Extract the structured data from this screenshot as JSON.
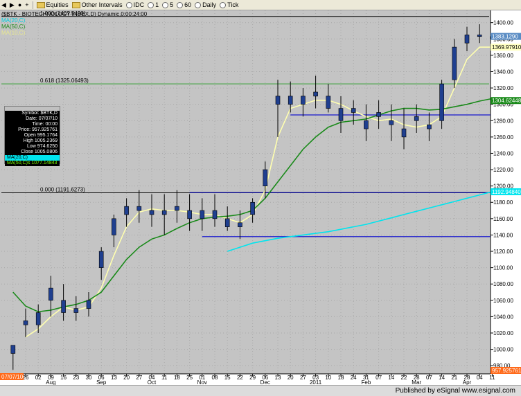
{
  "toolbar": {
    "items": [
      "Equities",
      "Other Intervals",
      "IDC",
      "1",
      "5",
      "60",
      "Daily",
      "Tick"
    ]
  },
  "chart_header": {
    "title": "($BTK - BIOTECHNOLOGY INDEX,D) Dynamic,0:00:24:00",
    "ind_ma20": "MA(20,C)",
    "ind_ma50": "MA(50,C)",
    "ind_ma10": "MA(10,C)"
  },
  "databox": {
    "header": "OK",
    "symbol": "Symbol: $BTK,D",
    "date": "Date: 07/07/10",
    "time": "Time: 00:00",
    "price": "Price: 957.925761",
    "open": "Open 995.1764",
    "high": "High 1005.2369",
    "low": "Low 974.6250",
    "close": "Close 1005.0806",
    "ma20": "MA(20,C)",
    "ma50": "MA(50,C)s 1077.14843"
  },
  "footer": {
    "text": "Published by eSignal  www.esignal.com"
  },
  "chart_data": {
    "type": "line",
    "title": "($BTK - BIOTECHNOLOGY INDEX,D) Dynamic,0:00:24:00",
    "xlabel": "",
    "ylabel": "",
    "ylim": [
      970,
      1415
    ],
    "grid": true,
    "y_ticks": [
      980,
      1000,
      1020,
      1040,
      1060,
      1080,
      1100,
      1120,
      1140,
      1160,
      1180,
      1200,
      1220,
      1240,
      1260,
      1280,
      1300,
      1320,
      1340,
      1360,
      1380,
      1400
    ],
    "x_tick_labels": [
      "19",
      "26",
      "02",
      "09",
      "16",
      "23",
      "30",
      "06",
      "13",
      "20",
      "27",
      "04",
      "11",
      "18",
      "25",
      "01",
      "08",
      "15",
      "22",
      "29",
      "06",
      "13",
      "20",
      "27",
      "03",
      "10",
      "18",
      "24",
      "31",
      "07",
      "14",
      "22",
      "28",
      "07",
      "14",
      "21",
      "28",
      "04",
      "11"
    ],
    "month_labels": [
      {
        "label": "Aug",
        "tick": 3
      },
      {
        "label": "Sep",
        "tick": 7
      },
      {
        "label": "Oct",
        "tick": 11
      },
      {
        "label": "Nov",
        "tick": 15
      },
      {
        "label": "Dec",
        "tick": 20
      },
      {
        "label": "2011",
        "tick": 24
      },
      {
        "label": "Feb",
        "tick": 28
      },
      {
        "label": "Mar",
        "tick": 32
      },
      {
        "label": "Apr",
        "tick": 36
      }
    ],
    "price_labels": [
      {
        "text": "1383.1290",
        "value": 1383.13,
        "bg": "#5a8cc4",
        "fg": "#ffffff"
      },
      {
        "text": "1369.97910",
        "value": 1369.98,
        "bg": "#ffffc0",
        "fg": "#000000"
      },
      {
        "text": "1304.62448",
        "value": 1304.62,
        "bg": "#1a8a1a",
        "fg": "#ffffff"
      },
      {
        "text": "1192.94840",
        "value": 1192.95,
        "bg": "#00e5ee",
        "fg": "#ffffff"
      },
      {
        "text": "957.925761",
        "value": 957.93,
        "bg": "#ff6a1a",
        "fg": "#ffffff"
      }
    ],
    "date_label": "07/07/10",
    "fib_levels": [
      {
        "label": "0.618 (1325.06493)",
        "value": 1325.06,
        "color": "#2f9e2f"
      },
      {
        "label": "0.000 (1191.6273)",
        "value": 1191.63,
        "color": "#000000"
      },
      {
        "label": "1.000 (1407.5490)",
        "value": 1407.55,
        "color": "#000000"
      }
    ],
    "horizontal_lines": [
      {
        "from_tick": 14,
        "to_tick": 39,
        "value": 1192,
        "color": "#1a1aa0"
      },
      {
        "from_tick": 15,
        "to_tick": 39,
        "value": 1138,
        "color": "#3333cc"
      },
      {
        "from_tick": 22,
        "to_tick": 38,
        "value": 1287,
        "color": "#3333cc"
      }
    ],
    "series": [
      {
        "name": "$BTK",
        "kind": "ohlc",
        "color": "#1f3f8f",
        "x": [
          0,
          1,
          2,
          3,
          4,
          5,
          6,
          7,
          8,
          9,
          10,
          11,
          12,
          13,
          14,
          15,
          16,
          17,
          18,
          19,
          20,
          21,
          22,
          23,
          24,
          25,
          26,
          27,
          28,
          29,
          30,
          31,
          32,
          33,
          34,
          35,
          36,
          37,
          38
        ],
        "open": [
          995,
          1035,
          1030,
          1075,
          1060,
          1045,
          1050,
          1100,
          1140,
          1165,
          1175,
          1170,
          1165,
          1175,
          1170,
          1160,
          1170,
          1160,
          1150,
          1165,
          1200,
          1300,
          1310,
          1300,
          1310,
          1310,
          1295,
          1290,
          1280,
          1290,
          1275,
          1270,
          1285,
          1270,
          1280,
          1330,
          1375,
          1385,
          1380
        ],
        "high": [
          1005,
          1050,
          1055,
          1090,
          1080,
          1065,
          1070,
          1125,
          1165,
          1185,
          1195,
          1190,
          1190,
          1195,
          1190,
          1185,
          1190,
          1175,
          1170,
          1185,
          1230,
          1330,
          1328,
          1320,
          1335,
          1325,
          1310,
          1305,
          1300,
          1305,
          1300,
          1295,
          1300,
          1290,
          1330,
          1380,
          1395,
          1398,
          1392
        ],
        "low": [
          975,
          1015,
          1020,
          1040,
          1035,
          1035,
          1040,
          1085,
          1125,
          1150,
          1155,
          1150,
          1140,
          1155,
          1145,
          1145,
          1150,
          1145,
          1135,
          1155,
          1185,
          1260,
          1290,
          1285,
          1295,
          1290,
          1265,
          1275,
          1255,
          1270,
          1255,
          1245,
          1265,
          1255,
          1270,
          1320,
          1365,
          1375,
          1370
        ],
        "close": [
          1005,
          1030,
          1045,
          1060,
          1045,
          1050,
          1060,
          1120,
          1160,
          1175,
          1170,
          1165,
          1170,
          1170,
          1160,
          1170,
          1160,
          1150,
          1155,
          1180,
          1220,
          1310,
          1300,
          1310,
          1315,
          1295,
          1280,
          1295,
          1270,
          1285,
          1280,
          1260,
          1280,
          1275,
          1325,
          1370,
          1385,
          1383,
          1383
        ]
      },
      {
        "name": "MA(10,C)",
        "color": "#ffffb0",
        "x": [
          1,
          2,
          3,
          4,
          5,
          6,
          7,
          8,
          9,
          10,
          11,
          12,
          13,
          14,
          15,
          16,
          17,
          18,
          19,
          20,
          21,
          22,
          23,
          24,
          25,
          26,
          27,
          28,
          29,
          30,
          31,
          32,
          33,
          34,
          35,
          36,
          37,
          38
        ],
        "values": [
          1015,
          1025,
          1040,
          1052,
          1048,
          1052,
          1075,
          1115,
          1150,
          1168,
          1172,
          1170,
          1170,
          1168,
          1165,
          1165,
          1160,
          1155,
          1165,
          1195,
          1260,
          1295,
          1300,
          1305,
          1305,
          1300,
          1292,
          1285,
          1280,
          1282,
          1275,
          1272,
          1275,
          1285,
          1320,
          1355,
          1370,
          1370
        ]
      },
      {
        "name": "MA(50,C)",
        "color": "#1a8a1a",
        "x": [
          0,
          1,
          2,
          3,
          4,
          5,
          6,
          7,
          8,
          9,
          10,
          11,
          12,
          13,
          14,
          15,
          16,
          17,
          18,
          19,
          20,
          21,
          22,
          23,
          24,
          25,
          26,
          27,
          28,
          29,
          30,
          31,
          32,
          33,
          34,
          35,
          36,
          37,
          38
        ],
        "values": [
          1070,
          1053,
          1046,
          1048,
          1052,
          1055,
          1060,
          1070,
          1090,
          1110,
          1125,
          1135,
          1140,
          1148,
          1155,
          1160,
          1162,
          1163,
          1165,
          1170,
          1185,
          1205,
          1225,
          1245,
          1260,
          1272,
          1278,
          1280,
          1282,
          1287,
          1292,
          1295,
          1295,
          1293,
          1294,
          1297,
          1300,
          1304,
          1307
        ]
      },
      {
        "name": "MA(200,C)",
        "color": "#00e5ee",
        "x": [
          17,
          18,
          19,
          20,
          21,
          22,
          23,
          24,
          25,
          26,
          27,
          28,
          29,
          30,
          31,
          32,
          33,
          34,
          35,
          36,
          37,
          38
        ],
        "values": [
          1120,
          1125,
          1130,
          1133,
          1136,
          1138,
          1140,
          1142,
          1144,
          1147,
          1150,
          1153,
          1157,
          1161,
          1165,
          1169,
          1173,
          1177,
          1181,
          1185,
          1189,
          1193
        ]
      }
    ]
  }
}
